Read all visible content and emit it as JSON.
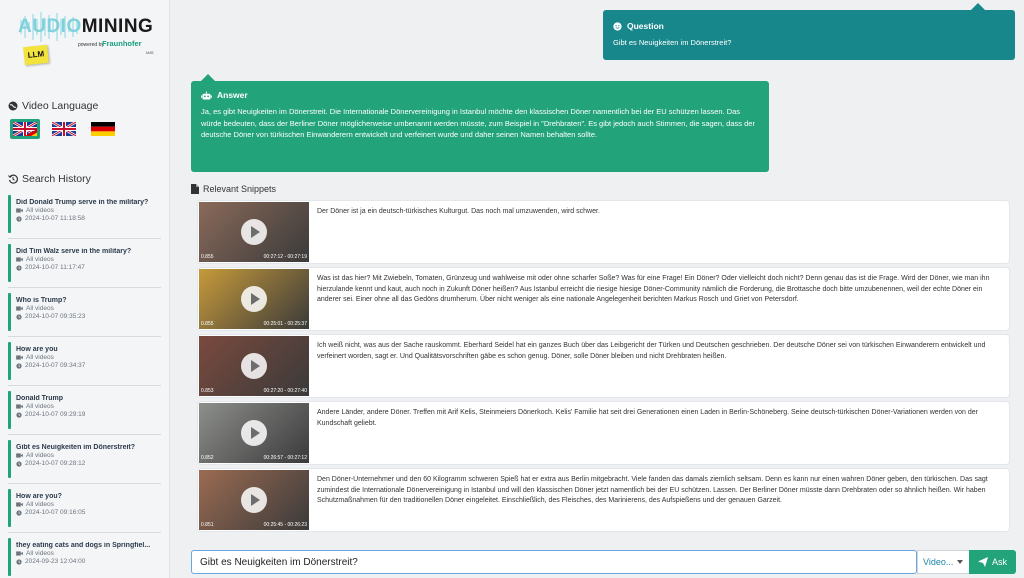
{
  "logo": {
    "audio": "AUDIO",
    "mining": "MINING",
    "llm": "LLM",
    "powered": "powered by",
    "fraunhofer": "Fraunhofer",
    "iais": "IAIS"
  },
  "sidebar": {
    "video_language_label": "Video Language",
    "search_history_label": "Search History",
    "flags": [
      {
        "name": "english-german",
        "selected": true
      },
      {
        "name": "english",
        "selected": false
      },
      {
        "name": "german",
        "selected": false
      }
    ],
    "history": [
      {
        "title": "Did Donald Trump serve in the military?",
        "scope": "All videos",
        "date": "2024-10-07 11:18:58"
      },
      {
        "title": "Did Tim Walz serve in the military?",
        "scope": "All videos",
        "date": "2024-10-07 11:17:47"
      },
      {
        "title": "Who is Trump?",
        "scope": "All videos",
        "date": "2024-10-07 09:35:23"
      },
      {
        "title": "How are you",
        "scope": "All videos",
        "date": "2024-10-07 09:34:37"
      },
      {
        "title": "Donald Trump",
        "scope": "All videos",
        "date": "2024-10-07 09:29:19"
      },
      {
        "title": "Gibt es Neuigkeiten im Dönerstreit?",
        "scope": "All videos",
        "date": "2024-10-07 09:28:12"
      },
      {
        "title": "How are you?",
        "scope": "All videos",
        "date": "2024-10-07 09:16:05"
      },
      {
        "title": "they eating cats and dogs in Springfiel...",
        "scope": "All videos",
        "date": "2024-09-23 12:04:00"
      }
    ]
  },
  "question": {
    "label": "Question",
    "text": "Gibt es Neuigkeiten im Dönerstreit?",
    "color": "#17878c"
  },
  "answer": {
    "label": "Answer",
    "text": "Ja, es gibt Neuigkeiten im Dönerstreit. Die Internationale Dönervereinigung in Istanbul möchte den klassischen Döner namentlich bei der EU schützen lassen. Das würde bedeuten, dass der Berliner Döner möglicherweise umbenannt werden müsste, zum Beispiel in \"Drehbraten\". Es gibt jedoch auch Stimmen, die sagen, dass der deutsche Döner von türkischen Einwanderern entwickelt und verfeinert wurde und daher seinen Namen behalten sollte.",
    "color": "#23a37a"
  },
  "snippets_label": "Relevant Snippets",
  "snippets": [
    {
      "score": "0.855",
      "time": "00:27:12 - 00:27:19",
      "text": "Der Döner ist ja ein deutsch-türkisches Kulturgut. Das noch mal umzuwenden, wird schwer.",
      "thumb_color": "#8a6a5a"
    },
    {
      "score": "0.855",
      "time": "00:25:01 - 00:25:37",
      "text": "Was ist das hier? Mit Zwiebeln, Tomaten, Grünzeug und wahlweise mit oder ohne scharfer Soße? Was für eine Frage! Ein Döner? Oder vielleicht doch nicht? Denn genau das ist die Frage. Wird der Döner, wie man ihn hierzulande kennt und kaut, auch noch in Zukunft Döner heißen? Aus Istanbul erreicht die riesige hiesige Döner-Community nämlich die Forderung, die Brottasche doch bitte umzubenennen, weil der echte Döner ein anderer sei. Einer ohne all das Gedöns drumherum. Über nicht weniger als eine nationale Angelegenheit berichten Markus Rosch und Griet von Petersdorf.",
      "thumb_color": "#c79a3a"
    },
    {
      "score": "0.853",
      "time": "00:27:20 - 00:27:40",
      "text": "Ich weiß nicht, was aus der Sache rauskommt. Eberhard Seidel hat ein ganzes Buch über das Leibgericht der Türken und Deutschen geschrieben. Der deutsche Döner sei von türkischen Einwanderern entwickelt und verfeinert worden, sagt er. Und Qualitätsvorschriften gäbe es schon genug. Döner, solle Döner bleiben und nicht Drehbraten heißen.",
      "thumb_color": "#7a4a3e"
    },
    {
      "score": "0.852",
      "time": "00:26:57 - 00:27:12",
      "text": "Andere Länder, andere Döner. Treffen mit Arif Kelis, Steinmeiers Dönerkoch. Kelis' Familie hat seit drei Generationen einen Laden in Berlin-Schöneberg. Seine deutsch-türkischen Döner-Variationen werden von der Kundschaft geliebt.",
      "thumb_color": "#8d8f8c"
    },
    {
      "score": "0.851",
      "time": "00:25:45 - 00:26:23",
      "text": "Den Döner-Unternehmer und den 60 Kilogramm schweren Spieß hat er extra aus Berlin mitgebracht. Viele fanden das damals ziemlich seltsam. Denn es kann nur einen wahren Döner geben, den türkischen. Das sagt zumindest die Internationale Dönervereinigung in Istanbul und will den klassischen Döner jetzt namentlich bei der EU schützen. Lassen. Der Berliner Döner müsste dann Drehbraten oder so ähnlich heißen. Wir haben Schutzmaßnahmen für den traditionellen Döner eingeleitet. Einschließlich, des Fleisches, des Marinierens, des Aufspießens und der genauen Garzeit.",
      "thumb_color": "#9b6b52"
    }
  ],
  "input": {
    "value": "Gibt es Neuigkeiten im Dönerstreit?"
  },
  "video_select": {
    "label": "Video..."
  },
  "ask_button": {
    "label": "Ask"
  }
}
